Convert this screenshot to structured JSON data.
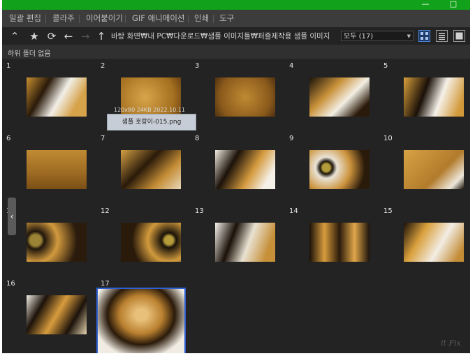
{
  "window": {
    "minimize_glyph": "—",
    "maximize_glyph": "□"
  },
  "menu": [
    {
      "label": "일괄 편집"
    },
    {
      "label": "콜라주"
    },
    {
      "label": "이어붙이기"
    },
    {
      "label": "GIF 애니메이션"
    },
    {
      "label": "인쇄"
    },
    {
      "label": "도구"
    }
  ],
  "toolbar": {
    "icons": [
      "chevron-up-icon",
      "star-icon",
      "refresh-icon",
      "back-arrow-icon",
      "forward-arrow-icon",
      "up-arrow-icon"
    ],
    "up_glyph": "⌃",
    "star_glyph": "★",
    "refresh_glyph": "⟳",
    "back_glyph": "←",
    "forward_glyph": "→",
    "parent_glyph": "↑",
    "path": "바탕 화면₩내 PC₩다운로드₩샘플 이미지들₩퍼즐제작용 샘플 이미지",
    "filter_value": "모두 (17)",
    "view_modes": [
      "thumbnail-view-icon",
      "list-view-icon",
      "preview-view-icon"
    ]
  },
  "info": {
    "subfolder_text": "하위 폴더 없음"
  },
  "thumbnails": [
    {
      "num": "1"
    },
    {
      "num": "2"
    },
    {
      "num": "3"
    },
    {
      "num": "4"
    },
    {
      "num": "5"
    },
    {
      "num": "6"
    },
    {
      "num": "7"
    },
    {
      "num": "8"
    },
    {
      "num": "9"
    },
    {
      "num": "10"
    },
    {
      "num": "11"
    },
    {
      "num": "12"
    },
    {
      "num": "13"
    },
    {
      "num": "14"
    },
    {
      "num": "15"
    },
    {
      "num": "16"
    },
    {
      "num": "17"
    }
  ],
  "tooltip": {
    "meta": "120x80  24KB  2022.10.11",
    "filename": "샘플 호랑이-015.png"
  },
  "side_handle_glyph": "‹",
  "watermark": "it Fix",
  "colors": {
    "title_bar": "#12a11a",
    "selection": "#2f60d6",
    "background": "#232323"
  }
}
